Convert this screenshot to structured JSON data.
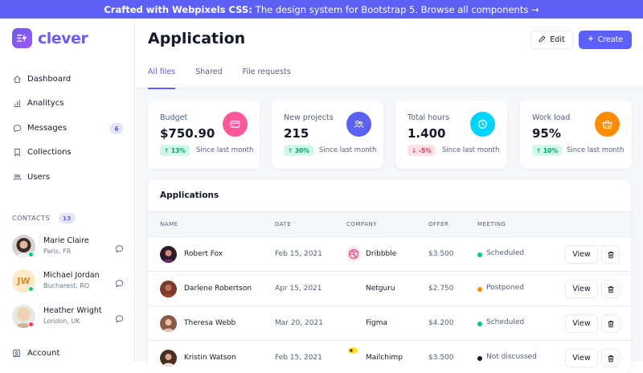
{
  "banner": {
    "strong": "Crafted with Webpixels CSS:",
    "text": "The design system for Bootstrap 5. Browse all components →"
  },
  "brand": {
    "name": "clever",
    "accent": "#5c60f5"
  },
  "nav": {
    "items": [
      {
        "label": "Dashboard",
        "icon": "house-icon"
      },
      {
        "label": "Analitycs",
        "icon": "bar-chart-icon"
      },
      {
        "label": "Messages",
        "icon": "chat-icon",
        "badge": "6"
      },
      {
        "label": "Collections",
        "icon": "bookmark-icon"
      },
      {
        "label": "Users",
        "icon": "people-icon"
      }
    ]
  },
  "contacts": {
    "heading": "CONTACTS",
    "count": "13",
    "list": [
      {
        "name": "Marie Claire",
        "location": "Paris, FR",
        "status_color": "#00cc88"
      },
      {
        "name": "Michael Jordan",
        "location": "Bucharest, RO",
        "initials": "JW",
        "status_color": "#00cc88"
      },
      {
        "name": "Heather Wright",
        "location": "London, UK",
        "status_color": "#ff3366"
      }
    ]
  },
  "account": {
    "label": "Account",
    "icon": "person-square-icon"
  },
  "header": {
    "title": "Application",
    "edit_label": "Edit",
    "create_label": "Create",
    "tabs": [
      "All files",
      "Shared",
      "File requests"
    ]
  },
  "stats": [
    {
      "label": "Budget",
      "value": "$750.90",
      "change": "13%",
      "direction": "up",
      "since": "Since last month",
      "icon": "credit-card-icon",
      "color": "#ff579a"
    },
    {
      "label": "New projects",
      "value": "215",
      "change": "30%",
      "direction": "up",
      "since": "Since last month",
      "icon": "people-icon",
      "color": "#5c60f5"
    },
    {
      "label": "Total hours",
      "value": "1.400",
      "change": "-5%",
      "direction": "down",
      "since": "Since last month",
      "icon": "clock-icon",
      "color": "#00d4ff"
    },
    {
      "label": "Work load",
      "value": "95%",
      "change": "10%",
      "direction": "up",
      "since": "Since last month",
      "icon": "basket-icon",
      "color": "#ff8c00"
    }
  ],
  "applications": {
    "title": "Applications",
    "columns": [
      "NAME",
      "DATE",
      "COMPANY",
      "OFFER",
      "MEETING"
    ],
    "view_label": "View",
    "rows": [
      {
        "name": "Robert Fox",
        "date": "Feb 15, 2021",
        "company": "Dribbble",
        "offer": "$3.500",
        "meeting": "Scheduled",
        "meeting_color": "#00cc88"
      },
      {
        "name": "Darlene Robertson",
        "date": "Apr 15, 2021",
        "company": "Netguru",
        "offer": "$2.750",
        "meeting": "Postponed",
        "meeting_color": "#ff8c00"
      },
      {
        "name": "Theresa Webb",
        "date": "Mar 20, 2021",
        "company": "Figma",
        "offer": "$4.200",
        "meeting": "Scheduled",
        "meeting_color": "#00cc88"
      },
      {
        "name": "Kristin Watson",
        "date": "Feb 15, 2021",
        "company": "Mailchimp",
        "offer": "$3.500",
        "meeting": "Not discussed",
        "meeting_color": "#16192c"
      }
    ]
  }
}
